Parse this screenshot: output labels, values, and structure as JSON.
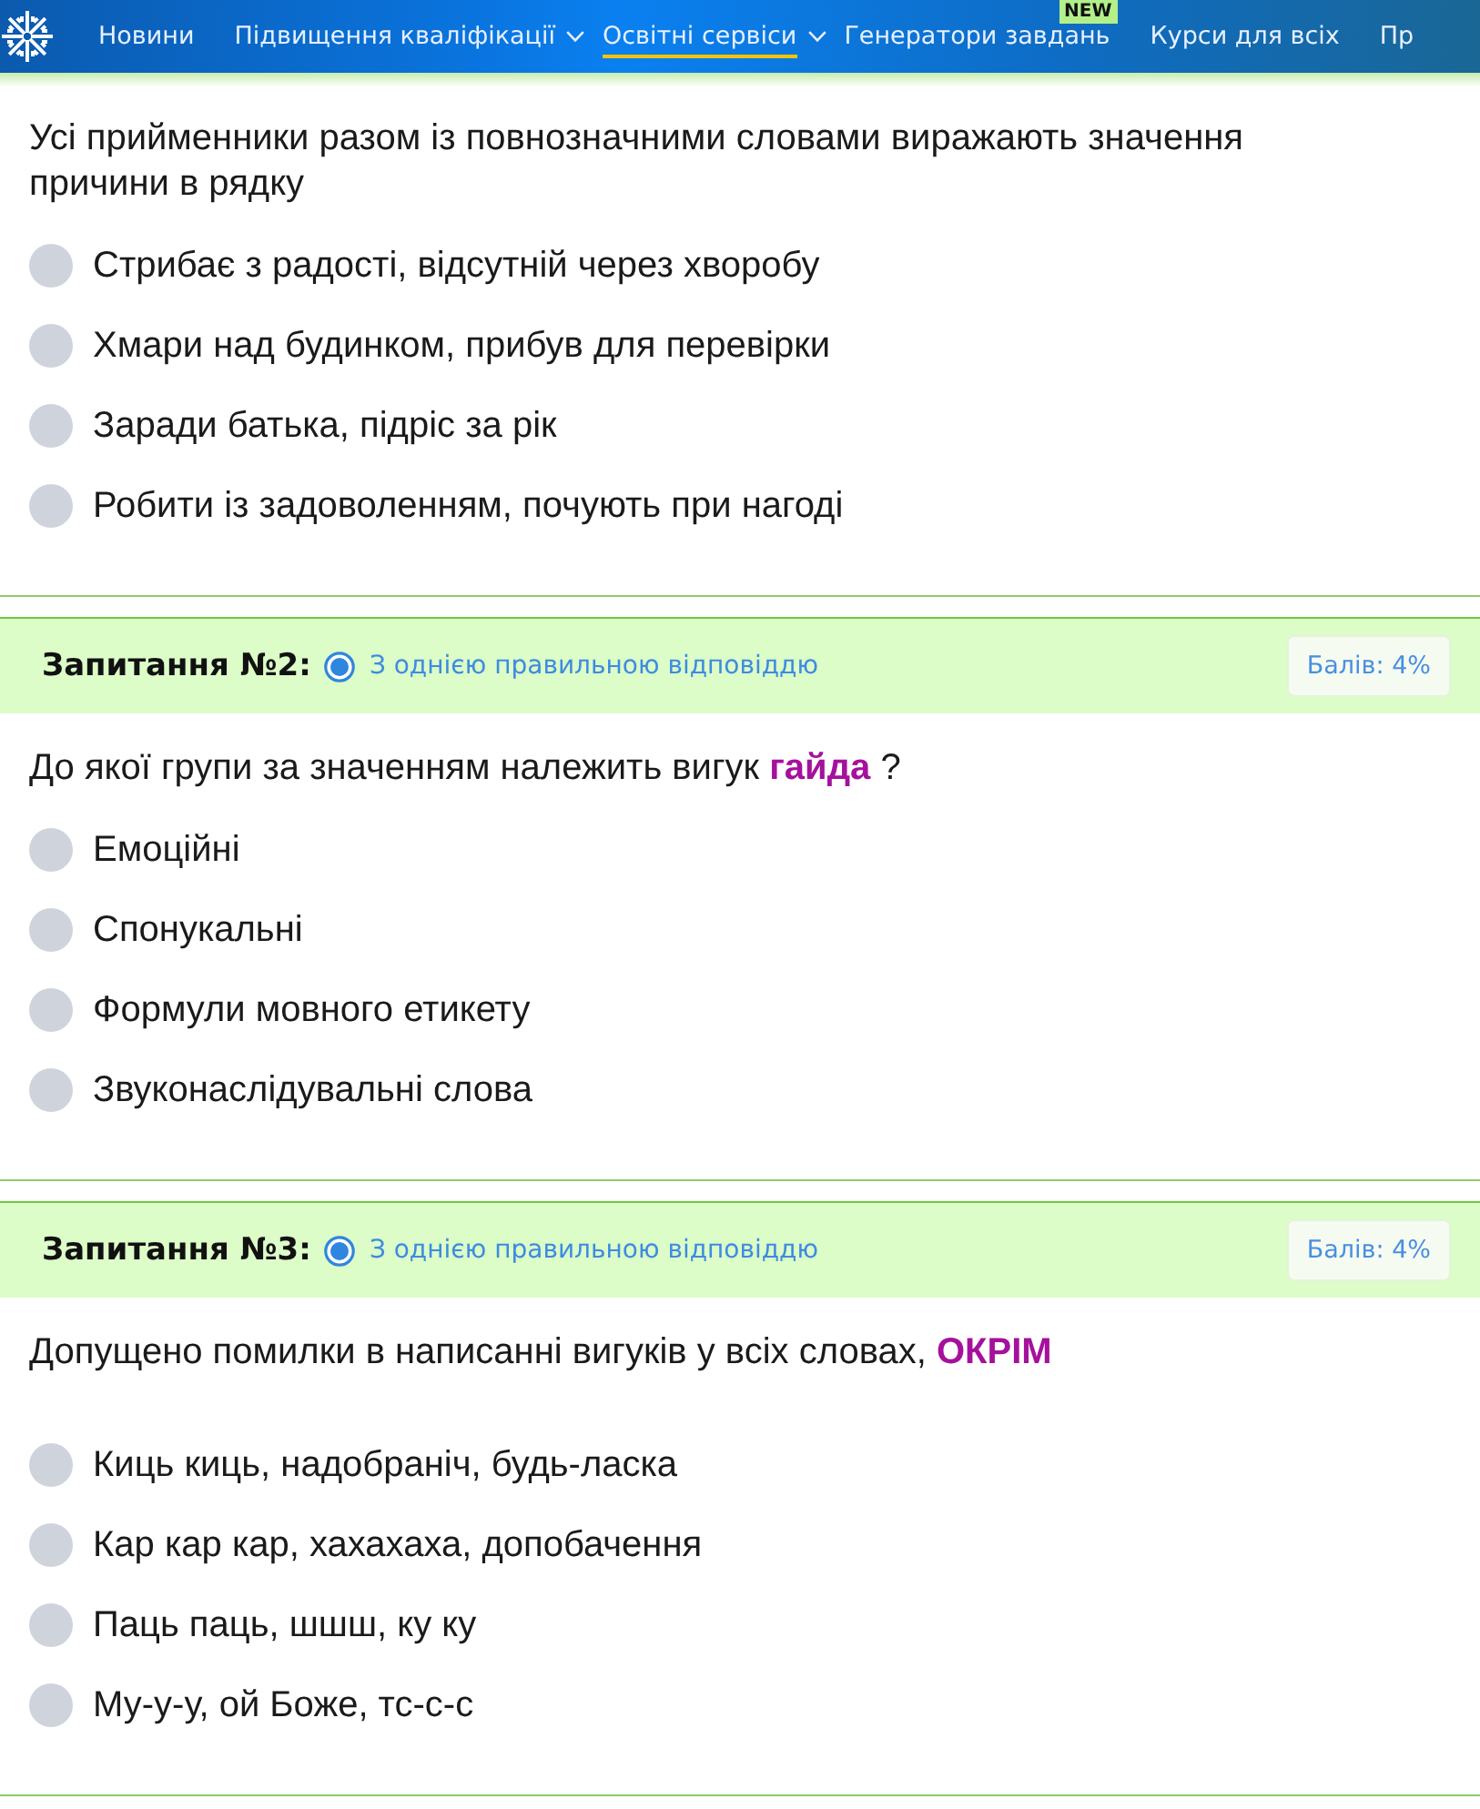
{
  "nav": {
    "items": [
      {
        "label": "Новини",
        "dropdown": false,
        "selected": false
      },
      {
        "label": "Підвищення кваліфікації",
        "dropdown": true,
        "selected": false
      },
      {
        "label": "Освітні сервіси",
        "dropdown": true,
        "selected": true
      },
      {
        "label": "Генератори завдань",
        "dropdown": false,
        "selected": false,
        "badge": "NEW"
      },
      {
        "label": "Курси для всіх",
        "dropdown": false,
        "selected": false
      },
      {
        "label": "Пр",
        "dropdown": false,
        "selected": false
      }
    ]
  },
  "questions": [
    {
      "text": "Усі прийменники разом із повнозначними словами виражають значення причини в рядку",
      "options": [
        {
          "label": "Стрибає з радості, відсутній через хворобу",
          "selected": false
        },
        {
          "label": "Хмари над будинком, прибув для перевірки",
          "selected": false
        },
        {
          "label": "Заради батька, підріс за рік",
          "selected": false
        },
        {
          "label": "Робити із задоволенням, почують при нагоді",
          "selected": false
        }
      ]
    },
    {
      "header": {
        "title": "Запитання №2:",
        "answer_type": "З однією правильною відповіддю",
        "score": "Балів: 4%"
      },
      "text": "До якої групи за значенням належить вигук **гайда** ?",
      "options": [
        {
          "label": "Емоційні",
          "selected": false
        },
        {
          "label": "Спонукальні",
          "selected": false
        },
        {
          "label": "Формули мовного етикету",
          "selected": false
        },
        {
          "label": "Звуконаслідувальні слова",
          "selected": false
        }
      ]
    },
    {
      "header": {
        "title": "Запитання №3:",
        "answer_type": "З однією правильною відповіддю",
        "score": "Балів: 4%"
      },
      "text": "Допущено помилки в написанні вигуків у всіх словах, **ОКРІМ**",
      "options": [
        {
          "label": "Киць киць, надобраніч, будь-ласка",
          "selected": false
        },
        {
          "label": "Кар кар кар, хахахаха, допобачення",
          "selected": false
        },
        {
          "label": "Паць паць, шшш, ку ку",
          "selected": false
        },
        {
          "label": "Му-у-у, ой Боже, тс-с-с",
          "selected": false
        }
      ]
    }
  ]
}
